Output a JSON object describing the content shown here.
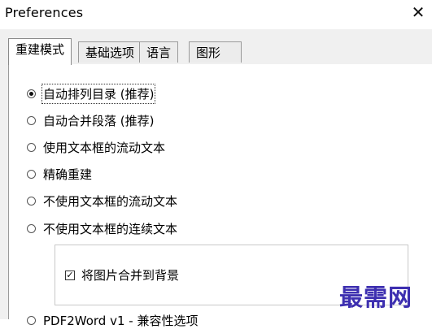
{
  "window": {
    "title": "Preferences",
    "close_glyph": "✕"
  },
  "tabs": [
    {
      "label": "重建模式",
      "active": true
    },
    {
      "label": "基础选项",
      "active": false
    },
    {
      "label": "语言",
      "active": false
    },
    {
      "label": "图形",
      "active": false
    }
  ],
  "radio_options": [
    {
      "label": "自动排列目录 (推荐)",
      "checked": true
    },
    {
      "label": "自动合并段落 (推荐)",
      "checked": false
    },
    {
      "label": "使用文本框的流动文本",
      "checked": false
    },
    {
      "label": "精确重建",
      "checked": false
    },
    {
      "label": "不使用文本框的流动文本",
      "checked": false
    },
    {
      "label": "不使用文本框的连续文本",
      "checked": false
    },
    {
      "label": "PDF2Word v1 - 兼容性选项",
      "checked": false
    }
  ],
  "group": {
    "checkbox_label": "将图片合并到背景",
    "checkbox_checked": true
  },
  "watermark": "最需网",
  "colors": {
    "watermark": "#3d2fb0",
    "panel_bg": "#ffffff",
    "window_bg": "#f0f0f0"
  }
}
